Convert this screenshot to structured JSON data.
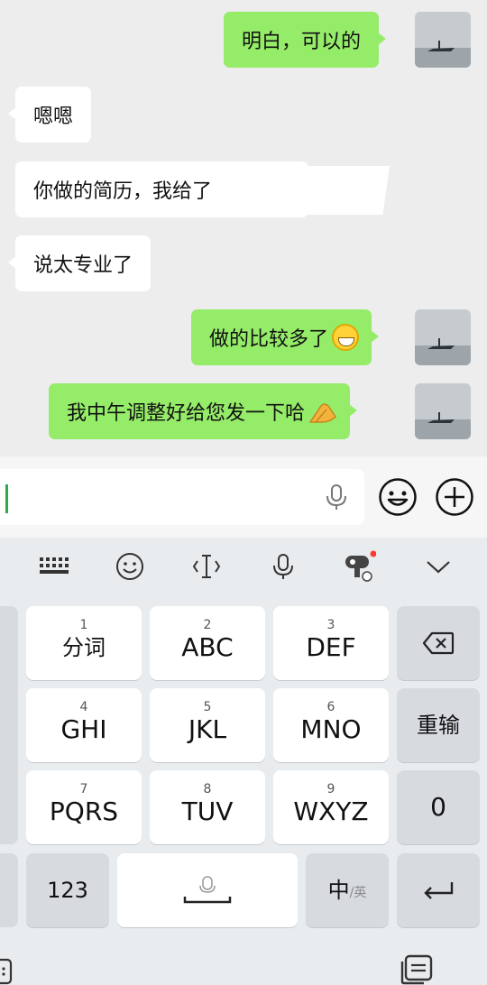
{
  "messages": [
    {
      "side": "mine",
      "text": "明白，可以的"
    },
    {
      "side": "theirs",
      "text": "嗯嗯"
    },
    {
      "side": "theirs",
      "text": "你做的简历，我给了"
    },
    {
      "side": "theirs",
      "text": "说太专业了"
    },
    {
      "side": "mine",
      "text": "做的比较多了",
      "emoji": "grin-face-icon"
    },
    {
      "side": "mine",
      "text": "我中午调整好给您发一下哈",
      "emoji": "clapping-hands-icon"
    }
  ],
  "input": {
    "value": "",
    "placeholder": ""
  },
  "toolbar_icons": [
    "keyboard-icon",
    "emoji-icon",
    "cursor-icon",
    "microphone-icon",
    "ai-assistant-icon",
    "chevron-down-icon"
  ],
  "keys": {
    "row1": [
      {
        "num": "1",
        "label": "分词"
      },
      {
        "num": "2",
        "label": "ABC"
      },
      {
        "num": "3",
        "label": "DEF"
      }
    ],
    "row2": [
      {
        "num": "4",
        "label": "GHI"
      },
      {
        "num": "5",
        "label": "JKL"
      },
      {
        "num": "6",
        "label": "MNO"
      }
    ],
    "row3": [
      {
        "num": "7",
        "label": "PQRS"
      },
      {
        "num": "8",
        "label": "TUV"
      },
      {
        "num": "9",
        "label": "WXYZ"
      }
    ],
    "reinput": "重输",
    "zero": "0",
    "num_switch": "123",
    "lang_main": "中",
    "lang_alt": "/英"
  },
  "colors": {
    "my_bubble": "#95ec69",
    "their_bubble": "#ffffff",
    "chat_bg": "#ededed",
    "keyboard_bg": "#e9ecef"
  }
}
